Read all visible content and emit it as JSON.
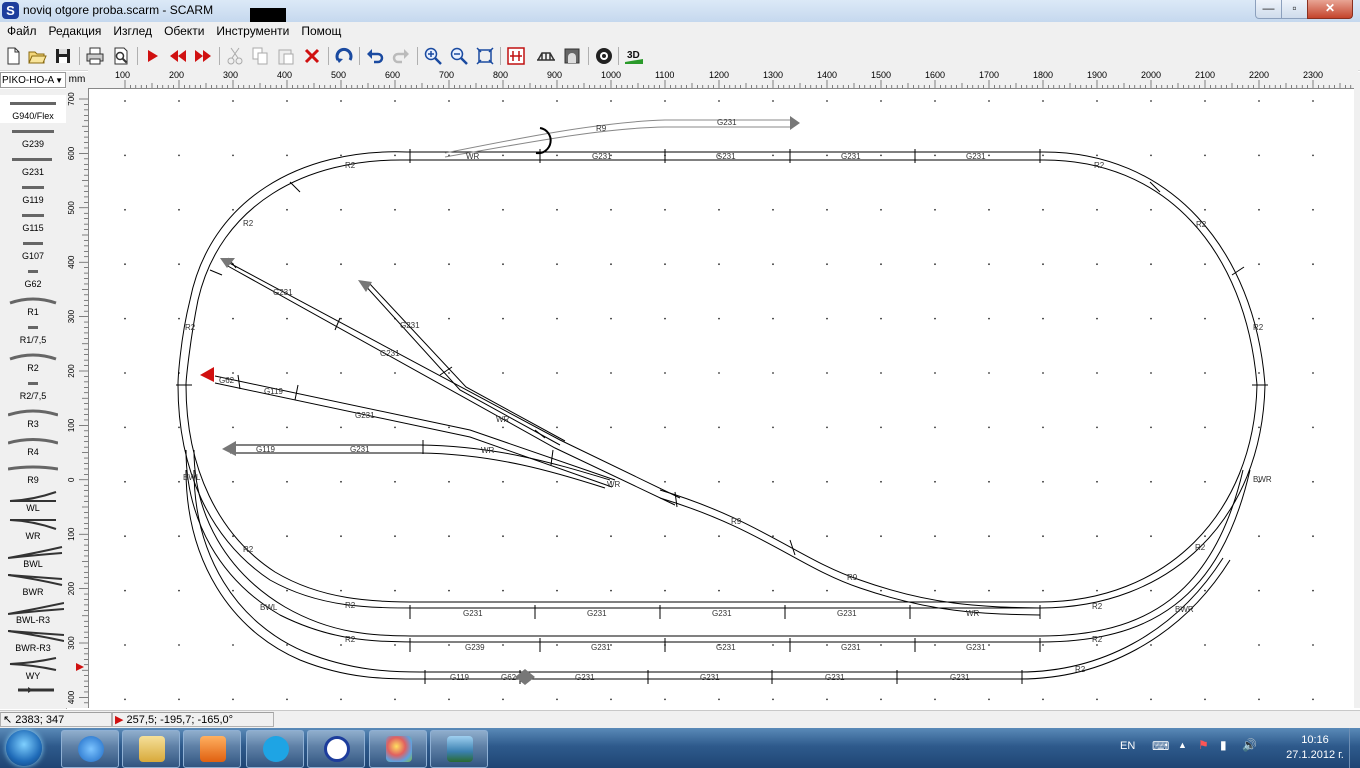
{
  "window": {
    "title": "noviq otgore proba.scarm - SCARM",
    "app_icon_letter": "S",
    "controls": {
      "minimize": "—",
      "maximize": "▫",
      "close": "✕"
    }
  },
  "menu": [
    "Файл",
    "Редакция",
    "Изглед",
    "Обекти",
    "Инструменти",
    "Помощ"
  ],
  "toolbar": {
    "icons": [
      "new-icon",
      "open-icon",
      "save-icon",
      "print-icon",
      "print-preview-icon",
      "play-icon",
      "rewind-icon",
      "forward-icon",
      "cut-icon",
      "copy-icon",
      "paste-icon",
      "delete-icon",
      "rotate-icon",
      "undo-icon",
      "redo-icon",
      "zoom-in-icon",
      "zoom-out-icon",
      "zoom-fit-icon",
      "track-tool-icon",
      "bridge-icon",
      "tunnel-icon",
      "target-icon",
      "view-3d-icon"
    ],
    "view_3d_label": "3D"
  },
  "library": {
    "selected": "PIKO-HO-A",
    "unit": "mm"
  },
  "palette": [
    "G940/Flex",
    "G239",
    "G231",
    "G119",
    "G115",
    "G107",
    "G62",
    "R1",
    "R1/7,5",
    "R2",
    "R2/7,5",
    "R3",
    "R4",
    "R9",
    "WL",
    "WR",
    "BWL",
    "BWR",
    "BWL-R3",
    "BWR-R3",
    "WY"
  ],
  "ruler": {
    "x_labels": [
      "100",
      "200",
      "300",
      "400",
      "500",
      "600",
      "700",
      "800",
      "900",
      "1000",
      "1100",
      "1200",
      "1300",
      "1400",
      "1500",
      "1600",
      "1700",
      "1800",
      "1900",
      "2000",
      "2100",
      "2200",
      "2300"
    ],
    "y_labels": [
      "700",
      "600",
      "500",
      "400",
      "300",
      "200",
      "100",
      "0",
      "100",
      "200",
      "300",
      "400"
    ]
  },
  "track_labels": {
    "top": [
      "R9",
      "G231",
      "WR",
      "G231",
      "G231",
      "G231",
      "G231",
      "R2"
    ],
    "left_upper": [
      "R2",
      "R2",
      "R2"
    ],
    "right": [
      "R2",
      "R2",
      "BWR",
      "R2",
      "BWR"
    ],
    "sidings": [
      "G231",
      "G231",
      "G231",
      "G62",
      "G119",
      "G231",
      "G119",
      "G231",
      "WR",
      "WR",
      "WR",
      "R9",
      "R9"
    ],
    "bottom1": [
      "G231",
      "G231",
      "G231",
      "G231",
      "WR",
      "R2"
    ],
    "bottom2": [
      "R2",
      "G239",
      "G231",
      "G231",
      "G231",
      "G231",
      "R2"
    ],
    "bottom3": [
      "R2",
      "G119",
      "G62",
      "G231",
      "G231",
      "G231",
      "G231",
      "R2"
    ],
    "left_lower": [
      "BWL",
      "R2",
      "BWL"
    ]
  },
  "status": {
    "cursor_pos": "2383; 347",
    "selection": "257,5; -195,7; -165,0°"
  },
  "taskbar": {
    "apps": [
      "internet-explorer",
      "file-explorer",
      "media-player",
      "skype",
      "scarm",
      "paint",
      "photo-viewer"
    ],
    "language": "EN",
    "time": "10:16",
    "date": "27.1.2012 г."
  }
}
